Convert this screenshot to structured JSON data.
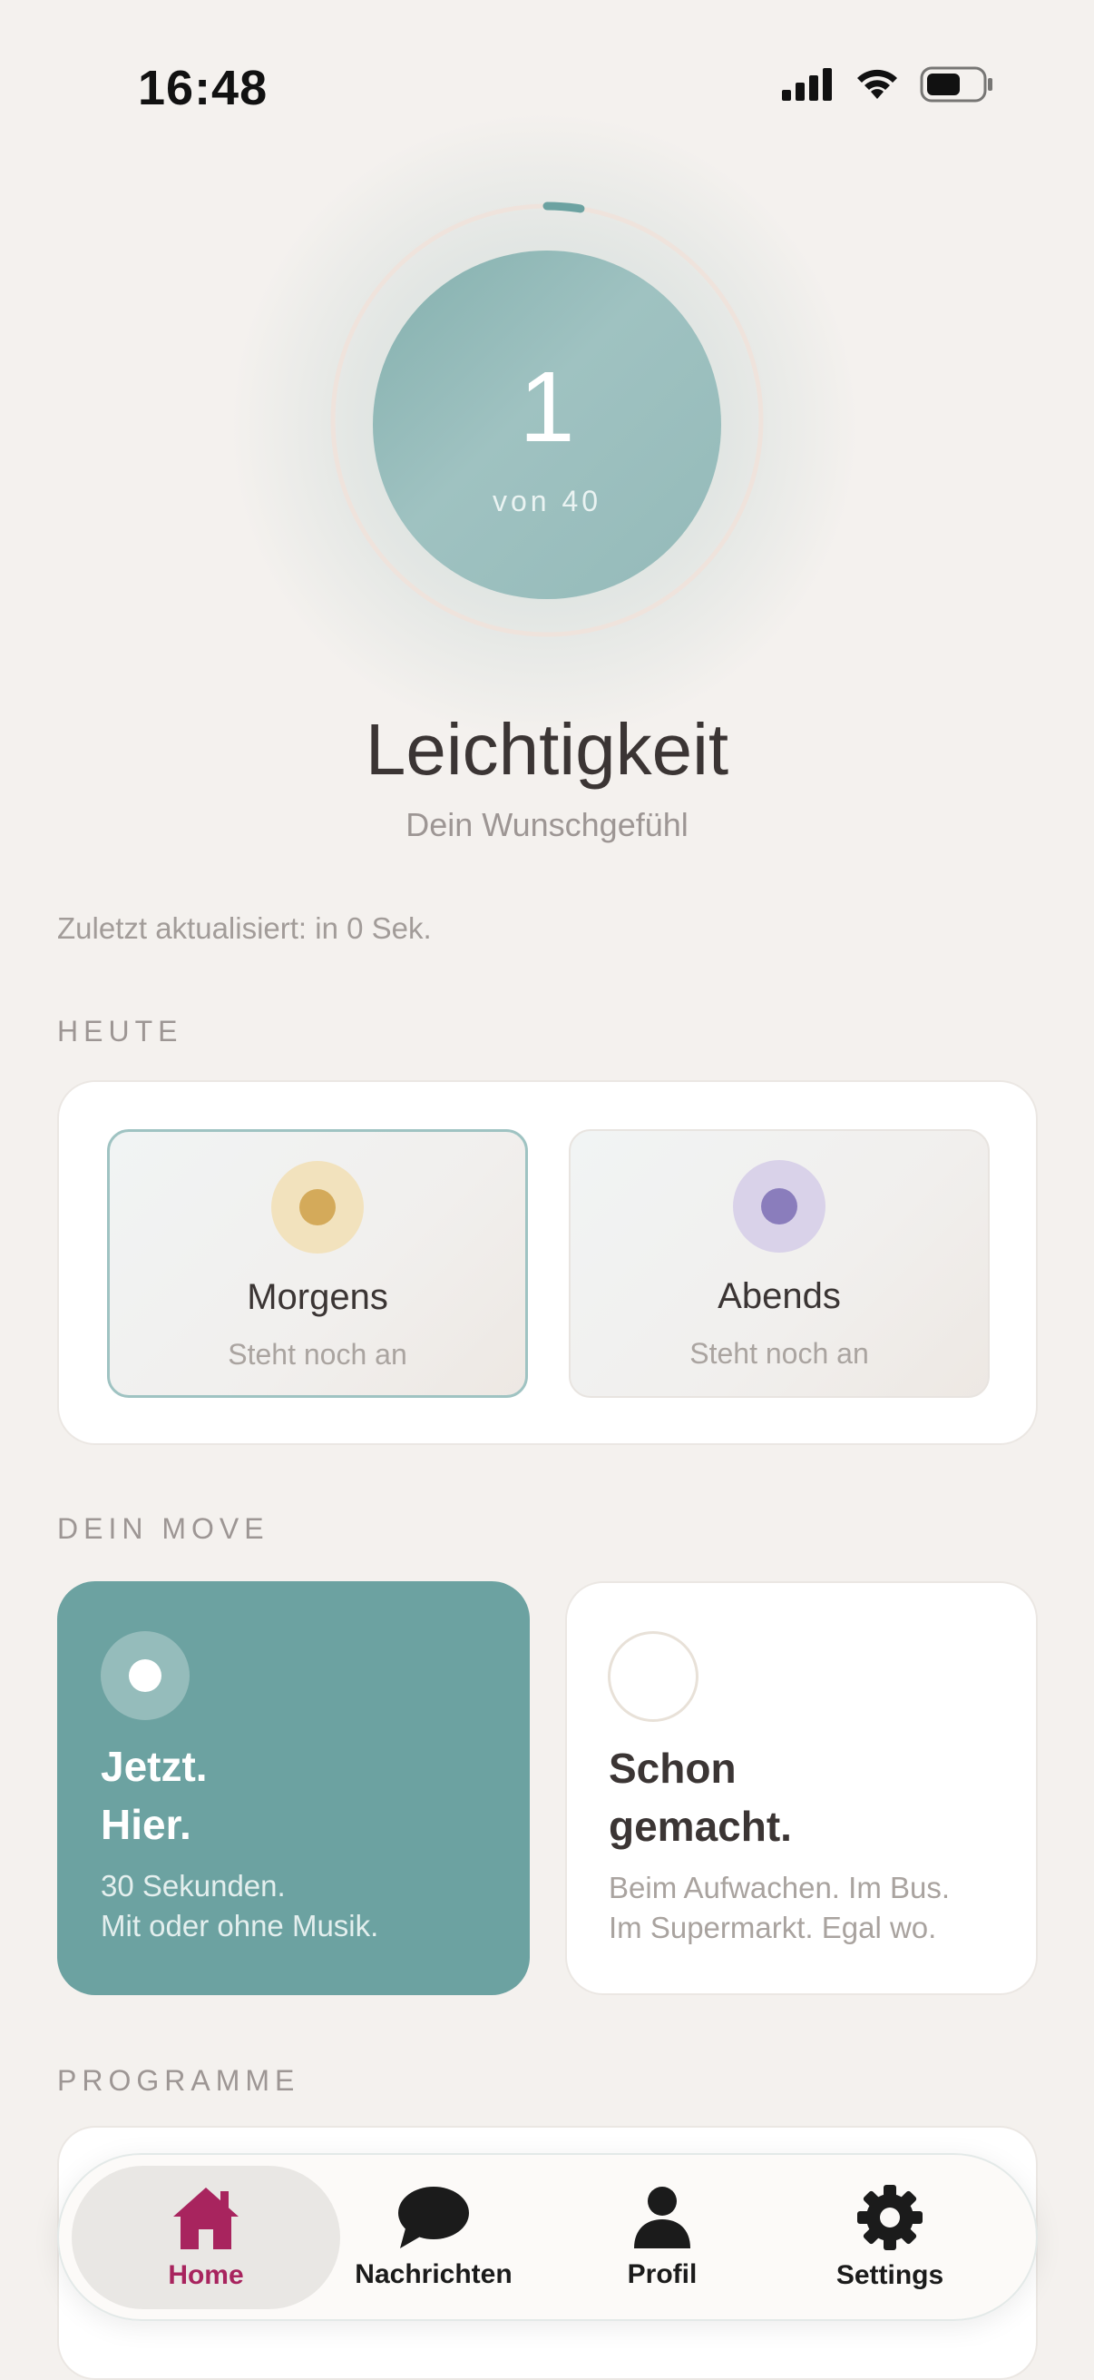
{
  "status_bar": {
    "time": "16:48"
  },
  "hero": {
    "count": "1",
    "of_label": "von 40",
    "progress_fraction": 0.025
  },
  "feeling": {
    "title": "Leichtigkeit",
    "subtitle": "Dein Wunschgefühl"
  },
  "updated_text": "Zuletzt aktualisiert: in 0 Sek.",
  "today": {
    "label": "HEUTE",
    "morning": {
      "title": "Morgens",
      "status": "Steht noch an"
    },
    "evening": {
      "title": "Abends",
      "status": "Steht noch an"
    }
  },
  "move": {
    "label": "DEIN MOVE",
    "now": {
      "title_line1": "Jetzt.",
      "title_line2": "Hier.",
      "desc_line1": "30 Sekunden.",
      "desc_line2": "Mit oder ohne Musik."
    },
    "done": {
      "title_line1": "Schon",
      "title_line2": "gemacht.",
      "desc_line1": "Beim Aufwachen. Im Bus.",
      "desc_line2": "Im Supermarkt. Egal wo."
    }
  },
  "programs": {
    "label": "PROGRAMME"
  },
  "tabs": [
    {
      "label": "Home",
      "icon": "home-icon"
    },
    {
      "label": "Nachrichten",
      "icon": "chat-bubble-icon"
    },
    {
      "label": "Profil",
      "icon": "person-icon"
    },
    {
      "label": "Settings",
      "icon": "gear-icon"
    }
  ],
  "colors": {
    "accent_teal": "#6ca2a1",
    "home_tab_active": "#a8245e",
    "morning_dot": "#d4aa5a",
    "evening_dot": "#8a7dbc"
  }
}
